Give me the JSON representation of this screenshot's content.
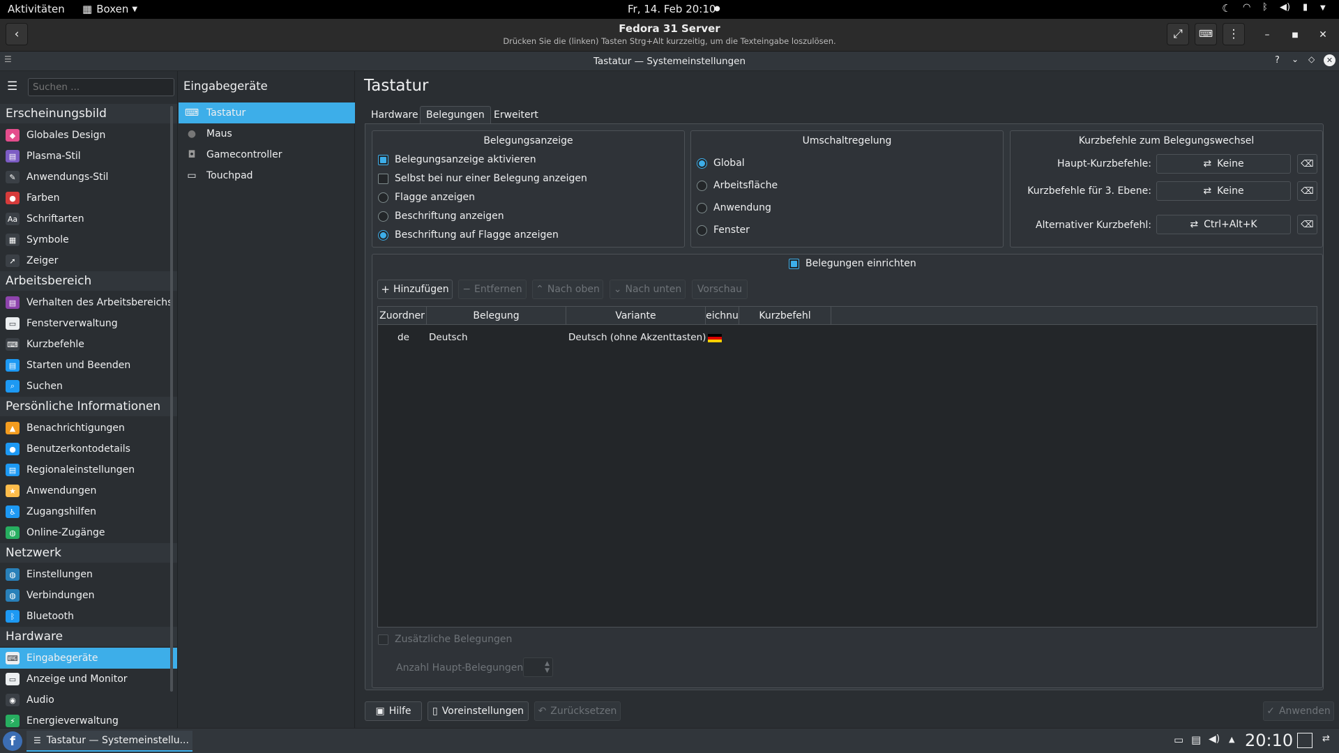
{
  "gnome": {
    "activities": "Aktivitäten",
    "app": "Boxen",
    "clock": "Fr, 14. Feb  20:10"
  },
  "boxes": {
    "title": "Fedora 31 Server",
    "hint": "Drücken Sie die (linken) Tasten Strg+Alt kurzzeitig, um die Texteingabe loszulösen."
  },
  "window": {
    "title": "Tastatur — Systemeinstellungen"
  },
  "sidebar": {
    "search_placeholder": "Suchen ...",
    "sections": [
      {
        "title": "Erscheinungsbild",
        "items": [
          "Globales Design",
          "Plasma-Stil",
          "Anwendungs-Stil",
          "Farben",
          "Schriftarten",
          "Symbole",
          "Zeiger"
        ]
      },
      {
        "title": "Arbeitsbereich",
        "items": [
          "Verhalten des Arbeitsbereichs",
          "Fensterverwaltung",
          "Kurzbefehle",
          "Starten und Beenden",
          "Suchen"
        ]
      },
      {
        "title": "Persönliche Informationen",
        "items": [
          "Benachrichtigungen",
          "Benutzerkontodetails",
          "Regionaleinstellungen",
          "Anwendungen",
          "Zugangshilfen",
          "Online-Zugänge"
        ]
      },
      {
        "title": "Netzwerk",
        "items": [
          "Einstellungen",
          "Verbindungen",
          "Bluetooth"
        ]
      },
      {
        "title": "Hardware",
        "items": [
          "Eingabegeräte",
          "Anzeige und Monitor",
          "Audio",
          "Energieverwaltung"
        ]
      }
    ],
    "selected": "Eingabegeräte"
  },
  "middle": {
    "title": "Eingabegeräte",
    "items": [
      "Tastatur",
      "Maus",
      "Gamecontroller",
      "Touchpad"
    ],
    "selected": "Tastatur"
  },
  "main": {
    "title": "Tastatur",
    "tabs": [
      "Hardware",
      "Belegungen",
      "Erweitert"
    ],
    "active_tab": "Belegungen",
    "indicator": {
      "title": "Belegungsanzeige",
      "options": [
        {
          "label": "Belegungsanzeige aktivieren",
          "type": "checkbox",
          "checked": true
        },
        {
          "label": "Selbst bei nur einer Belegung anzeigen",
          "type": "checkbox",
          "checked": false
        },
        {
          "label": "Flagge anzeigen",
          "type": "radio",
          "checked": false
        },
        {
          "label": "Beschriftung anzeigen",
          "type": "radio",
          "checked": false
        },
        {
          "label": "Beschriftung auf Flagge anzeigen",
          "type": "radio",
          "checked": true
        }
      ]
    },
    "switching": {
      "title": "Umschaltregelung",
      "options": [
        "Global",
        "Arbeitsfläche",
        "Anwendung",
        "Fenster"
      ],
      "selected": "Global"
    },
    "shortcuts": {
      "title": "Kurzbefehle zum Belegungswechsel",
      "rows": [
        {
          "label": "Haupt-Kurzbefehle:",
          "value": "Keine"
        },
        {
          "label": "Kurzbefehle für 3. Ebene:",
          "value": "Keine"
        },
        {
          "label": "Alternativer Kurzbefehl:",
          "value": "Ctrl+Alt+K"
        }
      ]
    },
    "configure_layouts": "Belegungen einrichten",
    "toolbar": {
      "add": "Hinzufügen",
      "remove": "Entfernen",
      "up": "Nach oben",
      "down": "Nach unten",
      "preview": "Vorschau"
    },
    "table": {
      "headers": [
        "Zuordner",
        "Belegung",
        "Variante",
        "eichnu",
        "Kurzbefehl"
      ],
      "rows": [
        {
          "map": "de",
          "layout": "Deutsch",
          "variant": "Deutsch (ohne Akzenttasten)",
          "shortcut": ""
        }
      ]
    },
    "extra_layouts": "Zusätzliche Belegungen",
    "main_count_label": "Anzahl Haupt-Belegungen:"
  },
  "footer": {
    "help": "Hilfe",
    "defaults": "Voreinstellungen",
    "reset": "Zurücksetzen",
    "apply": "Anwenden"
  },
  "taskbar": {
    "task": "Tastatur  — Systemeinstellu...",
    "clock": "20:10"
  }
}
